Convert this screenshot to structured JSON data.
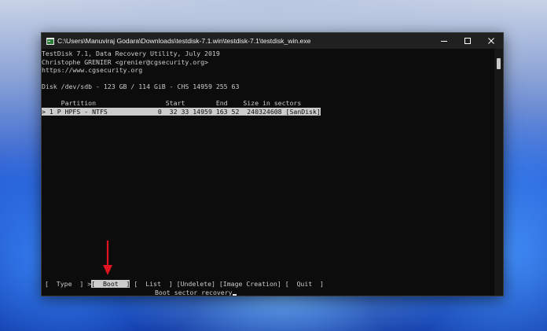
{
  "window": {
    "title": "C:\\Users\\Manuviraj Godara\\Downloads\\testdisk-7.1.win\\testdisk-7.1\\testdisk_win.exe",
    "minimize_glyph": "—",
    "maximize_glyph": "□",
    "close_glyph": "✕"
  },
  "console": {
    "header_lines": [
      "TestDisk 7.1, Data Recovery Utility, July 2019",
      "Christophe GRENIER <grenier@cgsecurity.org>",
      "https://www.cgsecurity.org"
    ],
    "disk_line": "Disk /dev/sdb - 123 GB / 114 GiB - CHS 14959 255 63",
    "table_header": "     Partition                  Start        End    Size in sectors",
    "partition_row": "> 1 P HPFS - NTFS             0  32 33 14959 163 52  240324608 [SanDisk]",
    "menu": {
      "type": "[  Type  ]",
      "boot_prefix": ">",
      "boot": "[  Boot  ]",
      "list": "[  List  ]",
      "undelete": "[Undelete]",
      "image_creation": "[Image Creation]",
      "quit": "[  Quit  ]"
    },
    "status_line": "Boot sector recovery"
  },
  "colors": {
    "console_bg": "#0c0c0c",
    "console_fg": "#cccccc",
    "highlight_bg": "#cccccc",
    "arrow": "#e0141e"
  },
  "icons": {
    "app": "console-app-icon",
    "annotation": "red-arrow-pointer"
  }
}
